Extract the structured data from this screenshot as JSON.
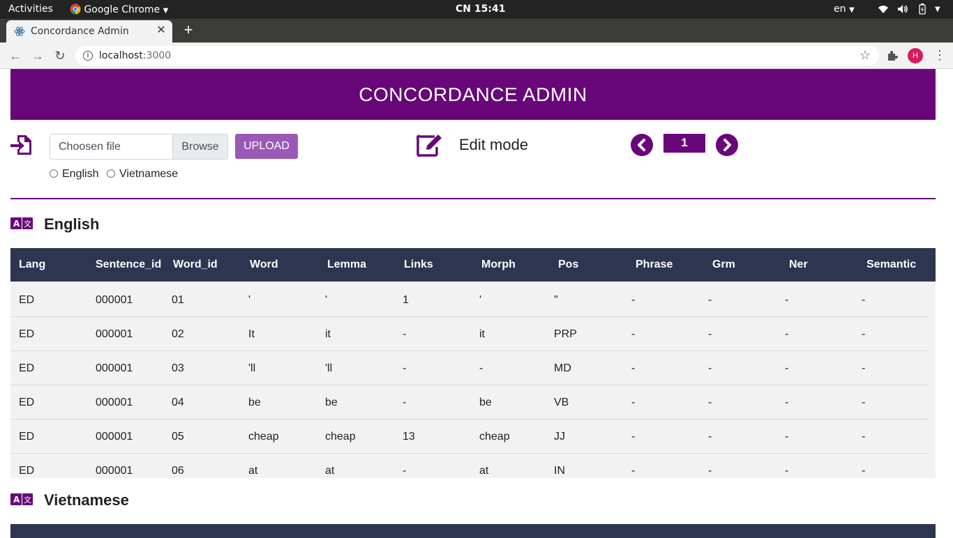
{
  "system": {
    "activities": "Activities",
    "app_name": "Google Chrome",
    "clock": "CN 15:41",
    "lang": "en"
  },
  "browser": {
    "tab_title": "Concordance Admin",
    "url_host": "localhost",
    "url_port": ":3000",
    "profile_initial": "H"
  },
  "page": {
    "header": "CONCORDANCE ADMIN",
    "file_placeholder": "Choosen file",
    "browse_label": "Browse",
    "upload_label": "UPLOAD",
    "radio_english": "English",
    "radio_vietnamese": "Vietnamese",
    "edit_mode": "Edit mode",
    "page_number": "1",
    "section_english": "English",
    "section_vietnamese": "Vietnamese"
  },
  "table": {
    "columns": [
      "Lang",
      "Sentence_id",
      "Word_id",
      "Word",
      "Lemma",
      "Links",
      "Morph",
      "Pos",
      "Phrase",
      "Grm",
      "Ner",
      "Semantic"
    ],
    "rows": [
      [
        "ED",
        "000001",
        "01",
        "'",
        "'",
        "1",
        "'",
        "''",
        "-",
        "-",
        "-",
        "-"
      ],
      [
        "ED",
        "000001",
        "02",
        "It",
        "it",
        "-",
        "it",
        "PRP",
        "-",
        "-",
        "-",
        "-"
      ],
      [
        "ED",
        "000001",
        "03",
        "'ll",
        "'ll",
        "-",
        "-",
        "MD",
        "-",
        "-",
        "-",
        "-"
      ],
      [
        "ED",
        "000001",
        "04",
        "be",
        "be",
        "-",
        "be",
        "VB",
        "-",
        "-",
        "-",
        "-"
      ],
      [
        "ED",
        "000001",
        "05",
        "cheap",
        "cheap",
        "13",
        "cheap",
        "JJ",
        "-",
        "-",
        "-",
        "-"
      ],
      [
        "ED",
        "000001",
        "06",
        "at",
        "at",
        "-",
        "at",
        "IN",
        "-",
        "-",
        "-",
        "-"
      ]
    ]
  },
  "colors": {
    "brand": "#68067a",
    "table_header": "#2d3551",
    "upload_button": "#9b59b6"
  }
}
